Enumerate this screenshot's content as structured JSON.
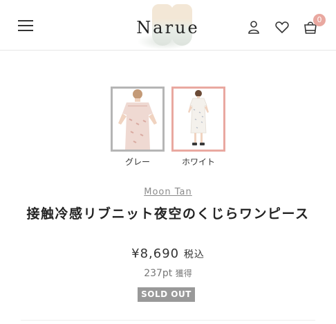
{
  "header": {
    "logo": "Narue",
    "cart_count": "0"
  },
  "icons": {
    "menu": "hamburger-menu-icon",
    "account": "user-icon",
    "wishlist": "heart-icon",
    "cart": "shopping-bag-icon"
  },
  "colors": {
    "accent": "#e9a8a0",
    "selected_border": "#e9a8a0",
    "unselected_border": "#b5b5b5",
    "soldout_bg": "#999999"
  },
  "variants": [
    {
      "label": "グレー",
      "selected": false
    },
    {
      "label": "ホワイト",
      "selected": true
    }
  ],
  "product": {
    "brand": "Moon Tan",
    "title": "接触冷感リブニット夜空のくじらワンピース",
    "price": "¥8,690",
    "tax_label": "税込",
    "points": "237pt",
    "points_suffix": "獲得",
    "status": "SOLD OUT"
  }
}
